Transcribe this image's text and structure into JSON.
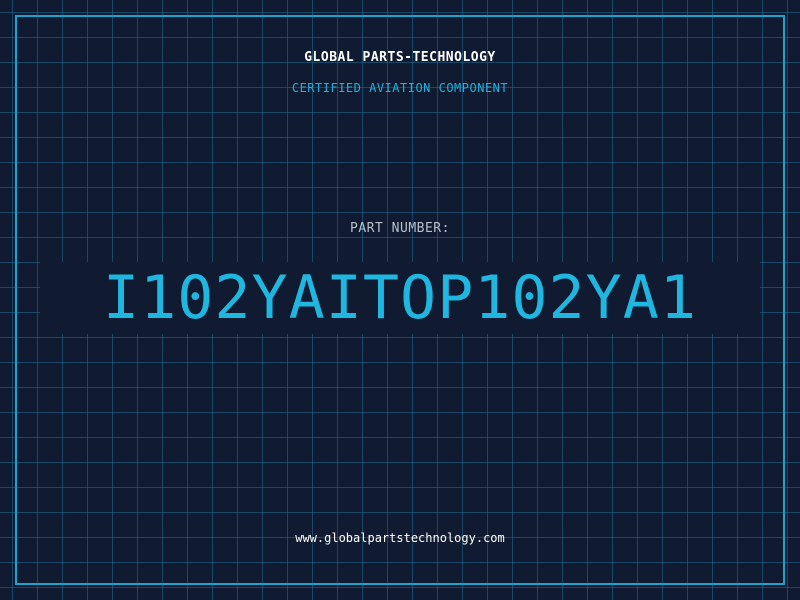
{
  "header": {
    "company": "GLOBAL PARTS-TECHNOLOGY",
    "tagline": "CERTIFIED AVIATION COMPONENT"
  },
  "part": {
    "label": "PART NUMBER:",
    "number": "I102YAITOP102YA1"
  },
  "footer": {
    "website": "www.globalpartstechnology.com"
  },
  "colors": {
    "background": "#101a30",
    "grid": "#206e96",
    "accent": "#1fb6e0",
    "border": "#1aa3cc"
  }
}
